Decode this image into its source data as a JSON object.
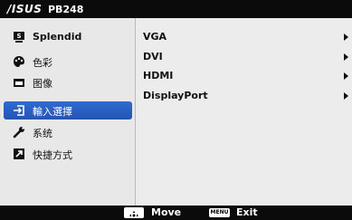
{
  "header": {
    "brand": "/ISUS",
    "model": "PB248"
  },
  "left_menu": [
    {
      "label": "Splendid",
      "icon": "splendid-icon"
    },
    {
      "label": "色彩",
      "icon": "palette-icon"
    },
    {
      "label": "图像",
      "icon": "image-icon"
    },
    {
      "label": "輸入選擇",
      "icon": "input-select-icon",
      "selected": true
    },
    {
      "label": "系统",
      "icon": "wrench-icon"
    },
    {
      "label": "快捷方式",
      "icon": "shortcut-icon"
    }
  ],
  "options": [
    "VGA",
    "DVI",
    "HDMI",
    "DisplayPort"
  ],
  "footer": {
    "move_label": "Move",
    "menu_key": "MENU",
    "exit_label": "Exit"
  },
  "colors": {
    "selected_bg": "#2f6bd2",
    "bar_bg": "#0b0b0b",
    "panel_bg": "#ececec"
  }
}
